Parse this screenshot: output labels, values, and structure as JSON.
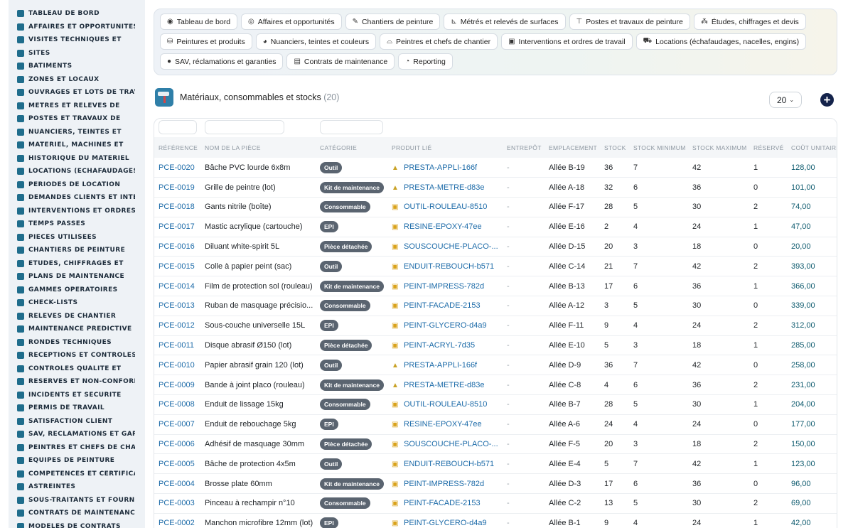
{
  "sidebar": {
    "items": [
      {
        "label": "TABLEAU DE BORD",
        "icon": "dashboard-icon"
      },
      {
        "label": "AFFAIRES ET OPPORTUNITÉS",
        "icon": "target-icon"
      },
      {
        "label": "VISITES TECHNIQUES ET",
        "icon": "clipboard-icon"
      },
      {
        "label": "SITES",
        "icon": "location-icon"
      },
      {
        "label": "BÂTIMENTS",
        "icon": "building-icon"
      },
      {
        "label": "ZONES ET LOCAUX",
        "icon": "grid-icon"
      },
      {
        "label": "OUVRAGES ET LOTS DE TRAVAUX",
        "icon": "sitemap-icon"
      },
      {
        "label": "MÉTRÉS ET RELEVÉS DE",
        "icon": "ruler-icon"
      },
      {
        "label": "POSTES ET TRAVAUX DE",
        "icon": "paint-roller-icon"
      },
      {
        "label": "NUANCIERS, TEINTES ET",
        "icon": "palette-icon"
      },
      {
        "label": "MATÉRIEL, MACHINES ET",
        "icon": "machine-icon"
      },
      {
        "label": "HISTORIQUE DU MATÉRIEL",
        "icon": "history-icon"
      },
      {
        "label": "LOCATIONS (ÉCHAFAUDAGES",
        "icon": "truck-icon"
      },
      {
        "label": "PÉRIODES DE LOCATION",
        "icon": "calendar-icon"
      },
      {
        "label": "DEMANDES CLIENTS ET INTER",
        "icon": "inbox-icon"
      },
      {
        "label": "INTERVENTIONS ET ORDRES",
        "icon": "clipboard-check-icon"
      },
      {
        "label": "TEMPS PASSÉS",
        "icon": "clock-icon"
      },
      {
        "label": "PIÈCES UTILISÉES",
        "icon": "puzzle-icon"
      },
      {
        "label": "CHANTIERS DE PEINTURE",
        "icon": "brush-icon"
      },
      {
        "label": "ÉTUDES, CHIFFRAGES ET",
        "icon": "calculator-icon"
      },
      {
        "label": "PLANS DE MAINTENANCE",
        "icon": "plan-icon"
      },
      {
        "label": "GAMMES OPÉRATOIRES",
        "icon": "list-icon"
      },
      {
        "label": "CHECK-LISTS",
        "icon": "checklist-icon"
      },
      {
        "label": "RELEVÉS DE CHANTIER",
        "icon": "notes-icon"
      },
      {
        "label": "MAINTENANCE PRÉDICTIVE",
        "icon": "chart-line-icon"
      },
      {
        "label": "RONDES TECHNIQUES",
        "icon": "route-icon"
      },
      {
        "label": "RÉCEPTIONS ET CONTRÔLES",
        "icon": "search-icon"
      },
      {
        "label": "CONTRÔLES QUALITÉ ET",
        "icon": "quality-icon"
      },
      {
        "label": "RÉSERVES ET NON-CONFORMITÉS",
        "icon": "alert-circle-icon"
      },
      {
        "label": "INCIDENTS ET SÉCURITÉ",
        "icon": "warning-icon"
      },
      {
        "label": "PERMIS DE TRAVAIL",
        "icon": "permit-icon"
      },
      {
        "label": "SATISFACTION CLIENT",
        "icon": "smile-icon"
      },
      {
        "label": "SAV, RÉCLAMATIONS ET GARANTIES",
        "icon": "chat-icon"
      },
      {
        "label": "PEINTRES ET CHEFS DE CHANTIER",
        "icon": "helmet-icon"
      },
      {
        "label": "ÉQUIPES DE PEINTURE",
        "icon": "team-icon"
      },
      {
        "label": "COMPÉTENCES ET CERTIFICATIONS",
        "icon": "certificate-icon"
      },
      {
        "label": "ASTREINTES",
        "icon": "phone-icon"
      },
      {
        "label": "SOUS-TRAITANTS ET FOURNISSEURS",
        "icon": "handshake-icon"
      },
      {
        "label": "CONTRATS DE MAINTENANCE",
        "icon": "contract-icon"
      },
      {
        "label": "MODÈLES DE CONTRATS",
        "icon": "file-icon"
      }
    ]
  },
  "modules": {
    "rows": [
      [
        {
          "label": "Tableau de bord",
          "icon": "dashboard-icon",
          "glyph": "◉"
        },
        {
          "label": "Affaires et opportunités",
          "icon": "target-icon",
          "glyph": "◎"
        },
        {
          "label": "Chantiers de peinture",
          "icon": "brush-icon",
          "glyph": "✎"
        },
        {
          "label": "Métrés et relevés de surfaces",
          "icon": "ruler-icon",
          "glyph": "⊾"
        },
        {
          "label": "Postes et travaux de peinture",
          "icon": "paint-roller-icon",
          "glyph": "⊤"
        },
        {
          "label": "Études, chiffrages et devis",
          "icon": "sitemap-icon",
          "glyph": "⁂"
        }
      ],
      [
        {
          "label": "Peintures et produits",
          "icon": "paint-bucket-icon",
          "glyph": "⛁"
        },
        {
          "label": "Nuanciers, teintes et couleurs",
          "icon": "palette-icon",
          "glyph": "◕"
        },
        {
          "label": "Peintres et chefs de chantier",
          "icon": "helmet-icon",
          "glyph": "⌓"
        },
        {
          "label": "Interventions et ordres de travail",
          "icon": "clipboard-check-icon",
          "glyph": "▣"
        },
        {
          "label": "Locations (échafaudages, nacelles, engins)",
          "icon": "truck-icon",
          "glyph": "⛟"
        }
      ],
      [
        {
          "label": "SAV, réclamations et garanties",
          "icon": "chat-icon",
          "glyph": "●"
        },
        {
          "label": "Contrats de maintenance",
          "icon": "contract-icon",
          "glyph": "▤"
        },
        {
          "label": "Reporting",
          "icon": "pie-chart-icon",
          "glyph": "◔"
        }
      ]
    ]
  },
  "header": {
    "title": "Matériaux, consommables et stocks",
    "count": "(20)",
    "page_size": "20"
  },
  "table": {
    "columns": [
      "RÉFÉRENCE",
      "NOM DE LA PIÈCE",
      "CATÉGORIE",
      "PRODUIT LIÉ",
      "ENTREPÔT",
      "EMPLACEMENT",
      "STOCK",
      "STOCK MINIMUM",
      "STOCK MAXIMUM",
      "RÉSERVÉ",
      "COÛT UNITAIRE"
    ],
    "rows": [
      {
        "ref": "PCE-0020",
        "name": "Bâche PVC lourde 6x8m",
        "cat": "Outil",
        "prod": "PRESTA-APPLI-166f",
        "picon": "triangle-icon",
        "ent": "-",
        "loc": "Allée B-19",
        "stock": "36",
        "min": "7",
        "max": "42",
        "res": "1",
        "cost": "128,00"
      },
      {
        "ref": "PCE-0019",
        "name": "Grille de peintre (lot)",
        "cat": "Kit de maintenance",
        "prod": "PRESTA-METRE-d83e",
        "picon": "triangle-icon",
        "ent": "-",
        "loc": "Allée A-18",
        "stock": "32",
        "min": "6",
        "max": "36",
        "res": "0",
        "cost": "101,00"
      },
      {
        "ref": "PCE-0018",
        "name": "Gants nitrile (boîte)",
        "cat": "Consommable",
        "prod": "OUTIL-ROULEAU-8510",
        "picon": "box-icon",
        "ent": "-",
        "loc": "Allée F-17",
        "stock": "28",
        "min": "5",
        "max": "30",
        "res": "2",
        "cost": "74,00"
      },
      {
        "ref": "PCE-0017",
        "name": "Mastic acrylique (cartouche)",
        "cat": "EPI",
        "prod": "RESINE-EPOXY-47ee",
        "picon": "box-icon",
        "ent": "-",
        "loc": "Allée E-16",
        "stock": "2",
        "min": "4",
        "max": "24",
        "res": "1",
        "cost": "47,00"
      },
      {
        "ref": "PCE-0016",
        "name": "Diluant white-spirit 5L",
        "cat": "Pièce détachée",
        "prod": "SOUSCOUCHE-PLACO-...",
        "picon": "box-icon",
        "ent": "-",
        "loc": "Allée D-15",
        "stock": "20",
        "min": "3",
        "max": "18",
        "res": "0",
        "cost": "20,00"
      },
      {
        "ref": "PCE-0015",
        "name": "Colle à papier peint (sac)",
        "cat": "Outil",
        "prod": "ENDUIT-REBOUCH-b571",
        "picon": "box-icon",
        "ent": "-",
        "loc": "Allée C-14",
        "stock": "21",
        "min": "7",
        "max": "42",
        "res": "2",
        "cost": "393,00"
      },
      {
        "ref": "PCE-0014",
        "name": "Film de protection sol (rouleau)",
        "cat": "Kit de maintenance",
        "prod": "PEINT-IMPRESS-782d",
        "picon": "box-icon",
        "ent": "-",
        "loc": "Allée B-13",
        "stock": "17",
        "min": "6",
        "max": "36",
        "res": "1",
        "cost": "366,00"
      },
      {
        "ref": "PCE-0013",
        "name": "Ruban de masquage précisio...",
        "cat": "Consommable",
        "prod": "PEINT-FACADE-2153",
        "picon": "box-icon",
        "ent": "-",
        "loc": "Allée A-12",
        "stock": "3",
        "min": "5",
        "max": "30",
        "res": "0",
        "cost": "339,00"
      },
      {
        "ref": "PCE-0012",
        "name": "Sous-couche universelle 15L",
        "cat": "EPI",
        "prod": "PEINT-GLYCERO-d4a9",
        "picon": "box-icon",
        "ent": "-",
        "loc": "Allée F-11",
        "stock": "9",
        "min": "4",
        "max": "24",
        "res": "2",
        "cost": "312,00"
      },
      {
        "ref": "PCE-0011",
        "name": "Disque abrasif Ø150 (lot)",
        "cat": "Pièce détachée",
        "prod": "PEINT-ACRYL-7d35",
        "picon": "box-icon",
        "ent": "-",
        "loc": "Allée E-10",
        "stock": "5",
        "min": "3",
        "max": "18",
        "res": "1",
        "cost": "285,00"
      },
      {
        "ref": "PCE-0010",
        "name": "Papier abrasif grain 120 (lot)",
        "cat": "Outil",
        "prod": "PRESTA-APPLI-166f",
        "picon": "triangle-icon",
        "ent": "-",
        "loc": "Allée D-9",
        "stock": "36",
        "min": "7",
        "max": "42",
        "res": "0",
        "cost": "258,00"
      },
      {
        "ref": "PCE-0009",
        "name": "Bande à joint placo (rouleau)",
        "cat": "Kit de maintenance",
        "prod": "PRESTA-METRE-d83e",
        "picon": "triangle-icon",
        "ent": "-",
        "loc": "Allée C-8",
        "stock": "4",
        "min": "6",
        "max": "36",
        "res": "2",
        "cost": "231,00"
      },
      {
        "ref": "PCE-0008",
        "name": "Enduit de lissage 15kg",
        "cat": "Consommable",
        "prod": "OUTIL-ROULEAU-8510",
        "picon": "box-icon",
        "ent": "-",
        "loc": "Allée B-7",
        "stock": "28",
        "min": "5",
        "max": "30",
        "res": "1",
        "cost": "204,00"
      },
      {
        "ref": "PCE-0007",
        "name": "Enduit de rebouchage 5kg",
        "cat": "EPI",
        "prod": "RESINE-EPOXY-47ee",
        "picon": "box-icon",
        "ent": "-",
        "loc": "Allée A-6",
        "stock": "24",
        "min": "4",
        "max": "24",
        "res": "0",
        "cost": "177,00"
      },
      {
        "ref": "PCE-0006",
        "name": "Adhésif de masquage 30mm",
        "cat": "Pièce détachée",
        "prod": "SOUSCOUCHE-PLACO-...",
        "picon": "box-icon",
        "ent": "-",
        "loc": "Allée F-5",
        "stock": "20",
        "min": "3",
        "max": "18",
        "res": "2",
        "cost": "150,00"
      },
      {
        "ref": "PCE-0005",
        "name": "Bâche de protection 4x5m",
        "cat": "Outil",
        "prod": "ENDUIT-REBOUCH-b571",
        "picon": "box-icon",
        "ent": "-",
        "loc": "Allée E-4",
        "stock": "5",
        "min": "7",
        "max": "42",
        "res": "1",
        "cost": "123,00"
      },
      {
        "ref": "PCE-0004",
        "name": "Brosse plate 60mm",
        "cat": "Kit de maintenance",
        "prod": "PEINT-IMPRESS-782d",
        "picon": "box-icon",
        "ent": "-",
        "loc": "Allée D-3",
        "stock": "17",
        "min": "6",
        "max": "36",
        "res": "0",
        "cost": "96,00"
      },
      {
        "ref": "PCE-0003",
        "name": "Pinceau à rechampir n°10",
        "cat": "Consommable",
        "prod": "PEINT-FACADE-2153",
        "picon": "box-icon",
        "ent": "-",
        "loc": "Allée C-2",
        "stock": "13",
        "min": "5",
        "max": "30",
        "res": "2",
        "cost": "69,00"
      },
      {
        "ref": "PCE-0002",
        "name": "Manchon microfibre 12mm (lot)",
        "cat": "EPI",
        "prod": "PEINT-GLYCERO-d4a9",
        "picon": "box-icon",
        "ent": "-",
        "loc": "Allée B-1",
        "stock": "9",
        "min": "4",
        "max": "24",
        "res": "1",
        "cost": "42,00"
      }
    ]
  },
  "colors": {
    "sidebar_bg": "#eef2f6",
    "link": "#1b6aa8",
    "badge": "#5a6470",
    "add_button": "#14234b"
  }
}
